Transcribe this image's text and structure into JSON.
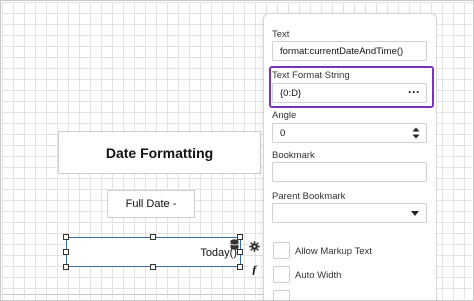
{
  "canvas": {
    "title_text": "Date Formatting",
    "full_date_text": "Full Date -",
    "selected_textbox_value": "Today()"
  },
  "panel": {
    "text": {
      "label": "Text",
      "value": "format:currentDateAndTime()"
    },
    "text_format_string": {
      "label": "Text Format String",
      "value": "{0:D}",
      "browse_label": "···"
    },
    "angle": {
      "label": "Angle",
      "value": "0"
    },
    "bookmark": {
      "label": "Bookmark",
      "value": ""
    },
    "parent_bookmark": {
      "label": "Parent Bookmark",
      "value": ""
    },
    "allow_markup_text": {
      "label": "Allow Markup Text",
      "checked": false
    },
    "auto_width": {
      "label": "Auto Width",
      "checked": false
    }
  },
  "icons": {
    "properties": "gear-icon",
    "expression": "function-icon",
    "data_binding": "database-icon"
  },
  "colors": {
    "highlight": "#7a33b5",
    "selection": "#3a6ea5"
  }
}
